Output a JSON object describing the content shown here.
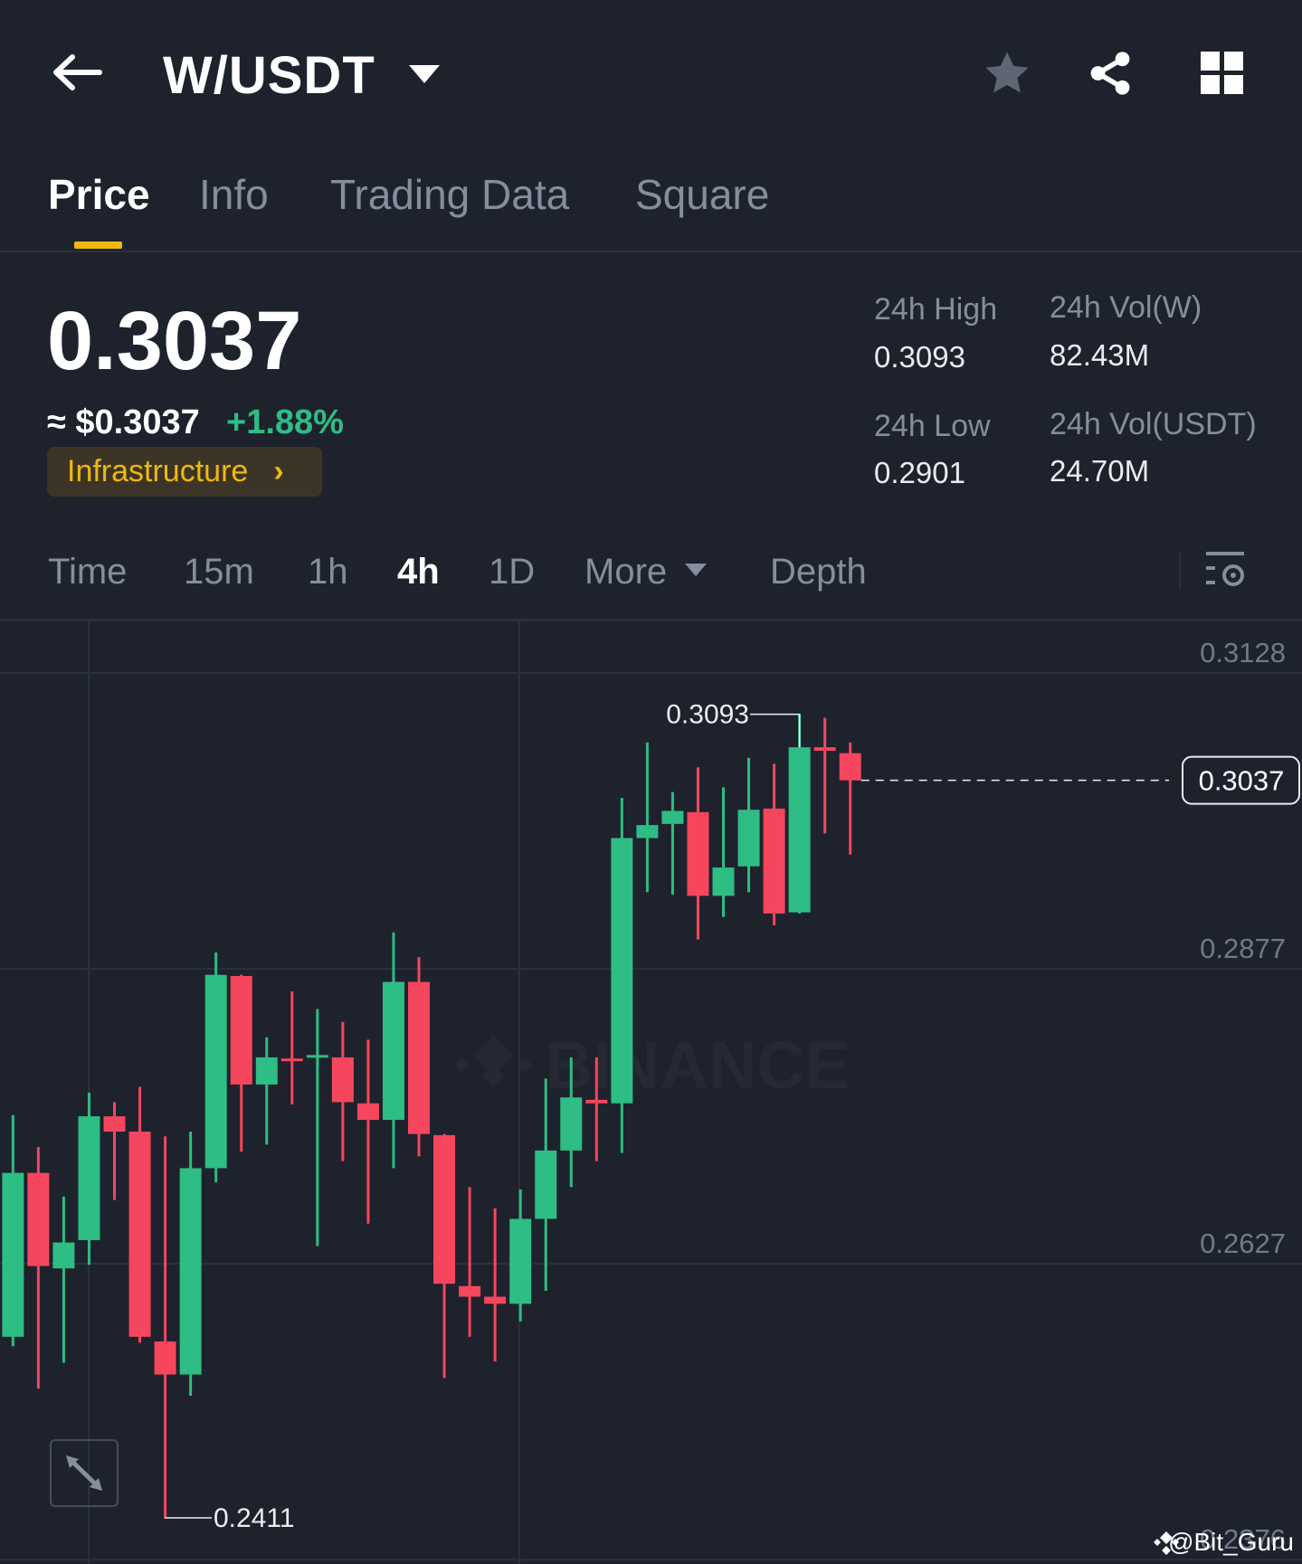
{
  "header": {
    "title": "W/USDT",
    "icons": [
      "back-arrow-icon",
      "caret-down-icon",
      "star-icon",
      "share-icon",
      "grid-icon"
    ]
  },
  "tabs": [
    {
      "label": "Price",
      "active": true
    },
    {
      "label": "Info"
    },
    {
      "label": "Trading Data"
    },
    {
      "label": "Square"
    }
  ],
  "ticker": {
    "last_price": "0.3037",
    "approx_usd": "≈ $0.3037",
    "change": "+1.88%",
    "tag": "Infrastructure",
    "stats": [
      {
        "label": "24h High",
        "value": "0.3093"
      },
      {
        "label": "24h Vol(W)",
        "value": "82.43M"
      },
      {
        "label": "24h Low",
        "value": "0.2901"
      },
      {
        "label": "24h Vol(USDT)",
        "value": "24.70M"
      }
    ]
  },
  "intervals": [
    {
      "label": "Time"
    },
    {
      "label": "15m"
    },
    {
      "label": "1h"
    },
    {
      "label": "4h",
      "active": true
    },
    {
      "label": "1D"
    },
    {
      "label": "More"
    },
    {
      "label": "Depth"
    }
  ],
  "colors": {
    "up": "#2ebd85",
    "down": "#f6465d",
    "accent": "#f0b90b"
  },
  "chart_data": {
    "type": "candlestick",
    "y_ticks": [
      "0.3128",
      "0.2877",
      "0.2627",
      "0.2376"
    ],
    "y_tick_values": [
      0.3128,
      0.2877,
      0.2627,
      0.2376
    ],
    "high_label": "0.3093",
    "low_label": "0.2411",
    "current_price_label": "0.3037",
    "current_price": 0.3037,
    "watermark": "BINANCE",
    "credit": "@Bit_Guru",
    "candles": [
      [
        0.2565,
        0.2704,
        0.2753,
        0.2557
      ],
      [
        0.2704,
        0.2625,
        0.2726,
        0.2521
      ],
      [
        0.2623,
        0.2645,
        0.2684,
        0.2543
      ],
      [
        0.2647,
        0.2752,
        0.2772,
        0.2626
      ],
      [
        0.2752,
        0.2739,
        0.2764,
        0.2681
      ],
      [
        0.2739,
        0.2565,
        0.2777,
        0.256
      ],
      [
        0.2561,
        0.2533,
        0.2735,
        0.2411
      ],
      [
        0.2533,
        0.2708,
        0.2739,
        0.2515
      ],
      [
        0.2708,
        0.2872,
        0.2891,
        0.2696
      ],
      [
        0.2871,
        0.2779,
        0.2872,
        0.2722
      ],
      [
        0.2779,
        0.2802,
        0.2819,
        0.2728
      ],
      [
        0.2801,
        0.2799,
        0.2858,
        0.2762
      ],
      [
        0.2802,
        0.2804,
        0.2843,
        0.2642
      ],
      [
        0.2802,
        0.2764,
        0.2832,
        0.2714
      ],
      [
        0.2763,
        0.2749,
        0.2817,
        0.2661
      ],
      [
        0.2749,
        0.2866,
        0.2908,
        0.2708
      ],
      [
        0.2866,
        0.2737,
        0.2887,
        0.2718
      ],
      [
        0.2736,
        0.261,
        0.2737,
        0.253
      ],
      [
        0.2608,
        0.2599,
        0.2692,
        0.2565
      ],
      [
        0.2599,
        0.2593,
        0.2674,
        0.2544
      ],
      [
        0.2593,
        0.2665,
        0.269,
        0.2578
      ],
      [
        0.2665,
        0.2723,
        0.2784,
        0.2604
      ],
      [
        0.2723,
        0.2768,
        0.2802,
        0.2692
      ],
      [
        0.2766,
        0.2763,
        0.2802,
        0.2714
      ],
      [
        0.2763,
        0.2988,
        0.3022,
        0.2721
      ],
      [
        0.2988,
        0.2999,
        0.3069,
        0.2942
      ],
      [
        0.3,
        0.3011,
        0.3027,
        0.294
      ],
      [
        0.301,
        0.2939,
        0.3048,
        0.2902
      ],
      [
        0.2939,
        0.2963,
        0.3031,
        0.2921
      ],
      [
        0.2964,
        0.3012,
        0.3056,
        0.2942
      ],
      [
        0.3013,
        0.2924,
        0.3051,
        0.2914
      ],
      [
        0.2925,
        0.3065,
        0.3093,
        0.2924
      ],
      [
        0.3065,
        0.3062,
        0.309,
        0.2992
      ],
      [
        0.306,
        0.3037,
        0.3069,
        0.2974
      ]
    ]
  }
}
